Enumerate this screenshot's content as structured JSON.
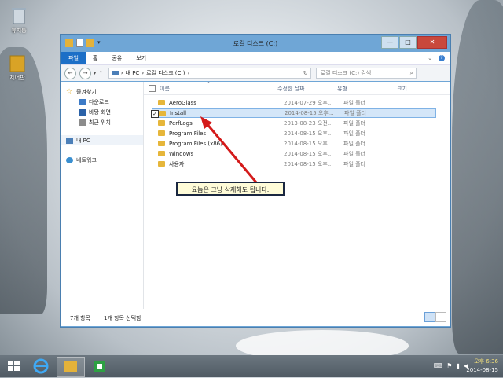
{
  "desktop": {
    "icons": [
      {
        "label": "휴지통",
        "icon": "recycle-bin-icon"
      },
      {
        "label": "제어판",
        "icon": "folder-icon"
      }
    ]
  },
  "window": {
    "title": "로컬 디스크 (C:)",
    "ribbon_tabs": [
      "파일",
      "홈",
      "공유",
      "보기"
    ],
    "nav": {
      "back": "←",
      "forward": "→",
      "up": "↑"
    },
    "address_path": [
      "내 PC",
      "로컬 디스크 (C:)"
    ],
    "search_placeholder": "로컬 디스크 (C:) 검색",
    "columns": {
      "name": "이름",
      "date": "수정한 날짜",
      "type": "유형",
      "size": "크기"
    },
    "sidebar": [
      {
        "label": "즐겨찾기",
        "icon": "star-icon"
      },
      {
        "label": "다운로드",
        "icon": "download-folder-icon"
      },
      {
        "label": "바탕 화면",
        "icon": "desktop-icon"
      },
      {
        "label": "최근 위치",
        "icon": "recent-places-icon"
      },
      {
        "label": "내 PC",
        "icon": "computer-icon"
      },
      {
        "label": "네트워크",
        "icon": "network-icon"
      }
    ],
    "files": [
      {
        "name": "AeroGlass",
        "date": "2014-07-29 오후...",
        "type": "파일 폴더"
      },
      {
        "name": "Install",
        "date": "2014-08-15 오후...",
        "type": "파일 폴더",
        "selected": true
      },
      {
        "name": "PerfLogs",
        "date": "2013-08-23 오전...",
        "type": "파일 폴더"
      },
      {
        "name": "Program Files",
        "date": "2014-08-15 오후...",
        "type": "파일 폴더"
      },
      {
        "name": "Program Files (x86)",
        "date": "2014-08-15 오후...",
        "type": "파일 폴더"
      },
      {
        "name": "Windows",
        "date": "2014-08-15 오후...",
        "type": "파일 폴더"
      },
      {
        "name": "사용자",
        "date": "2014-08-15 오후...",
        "type": "파일 폴더"
      }
    ],
    "status_count": "7개 항목",
    "status_selected": "1개 항목 선택함"
  },
  "callout": "요놈은 그냥 삭제해도 됩니다.",
  "taskbar": {
    "clock_time": "오후 6:36",
    "clock_date": "2014-08-15"
  }
}
